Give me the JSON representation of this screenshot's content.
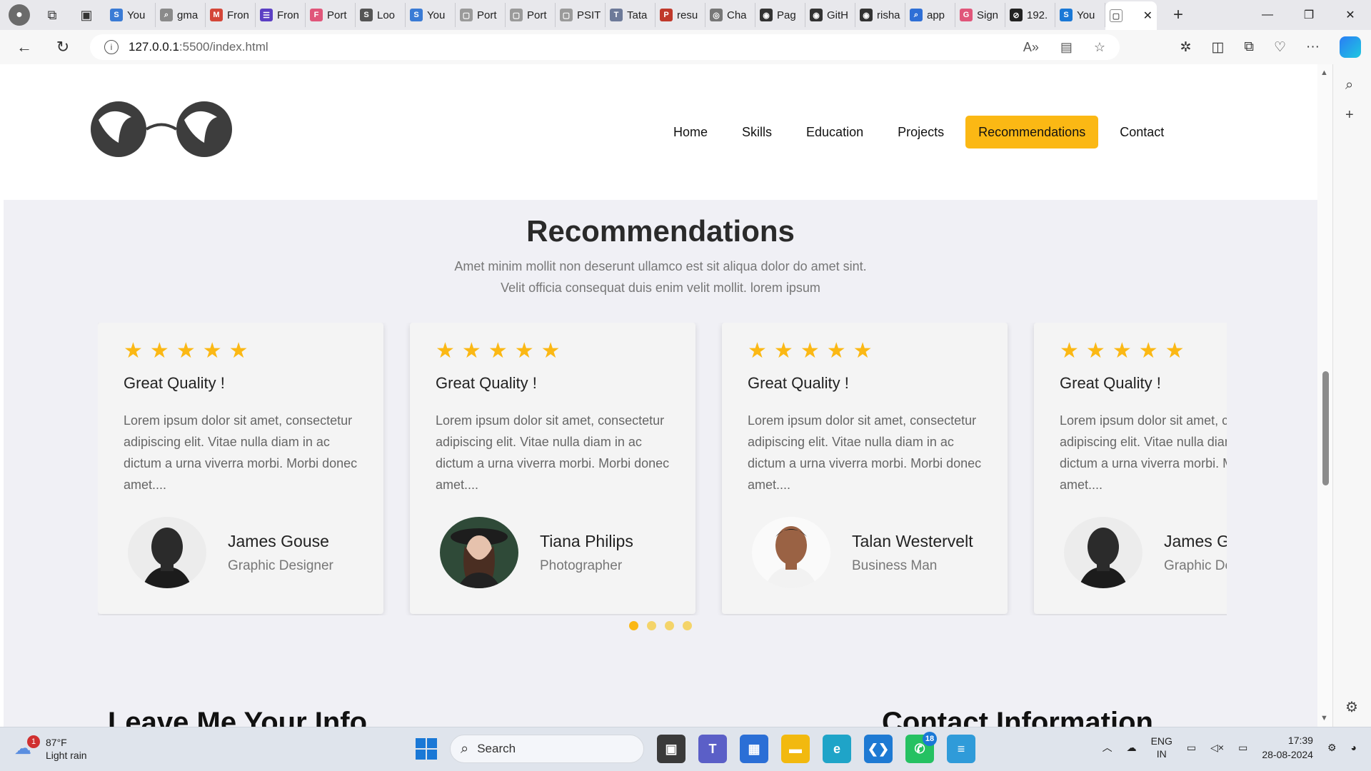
{
  "browser": {
    "tabs": [
      {
        "label": "You",
        "color": "#3a7bd5",
        "glyph": "S"
      },
      {
        "label": "gma",
        "color": "#8a8a8a",
        "glyph": "⌕"
      },
      {
        "label": "Fron",
        "color": "#d44638",
        "glyph": "M"
      },
      {
        "label": "Fron",
        "color": "#5b3fc4",
        "glyph": "☰"
      },
      {
        "label": "Port",
        "color": "#e0567a",
        "glyph": "F"
      },
      {
        "label": "Loo",
        "color": "#555555",
        "glyph": "S"
      },
      {
        "label": "You",
        "color": "#3a7bd5",
        "glyph": "S"
      },
      {
        "label": "Port",
        "color": "#9a9a9a",
        "glyph": "▢"
      },
      {
        "label": "Port",
        "color": "#9a9a9a",
        "glyph": "▢"
      },
      {
        "label": "PSIT",
        "color": "#9a9a9a",
        "glyph": "▢"
      },
      {
        "label": "Tata",
        "color": "#6d7a99",
        "glyph": "T"
      },
      {
        "label": "resu",
        "color": "#c0392b",
        "glyph": "P"
      },
      {
        "label": "Cha",
        "color": "#777777",
        "glyph": "◎"
      },
      {
        "label": "Pag",
        "color": "#333333",
        "glyph": "◉"
      },
      {
        "label": "GitH",
        "color": "#333333",
        "glyph": "◉"
      },
      {
        "label": "risha",
        "color": "#333333",
        "glyph": "◉"
      },
      {
        "label": "app",
        "color": "#2f6fd6",
        "glyph": "⌕"
      },
      {
        "label": "Sign",
        "color": "#e0567a",
        "glyph": "G"
      },
      {
        "label": "192.",
        "color": "#222222",
        "glyph": "⊘"
      },
      {
        "label": "You",
        "color": "#1a78d6",
        "glyph": "S"
      }
    ],
    "url_host": "127.0.0.1",
    "url_path": ":5500/index.html"
  },
  "nav": {
    "items": [
      "Home",
      "Skills",
      "Education",
      "Projects",
      "Recommendations",
      "Contact"
    ],
    "active": "Recommendations"
  },
  "section": {
    "title": "Recommendations",
    "subtitle_line1": "Amet minim mollit non deserunt ullamco est sit aliqua dolor do amet sint.",
    "subtitle_line2": "Velit officia consequat duis enim velit mollit. lorem ipsum"
  },
  "cards": [
    {
      "rating": 5,
      "heading": "Great Quality !",
      "text": "Lorem ipsum dolor sit amet, consectetur adipiscing elit. Vitae nulla diam in ac dictum a urna viverra morbi. Morbi donec amet....",
      "name": "James Gouse",
      "role": "Graphic Designer"
    },
    {
      "rating": 5,
      "heading": "Great Quality !",
      "text": "Lorem ipsum dolor sit amet, consectetur adipiscing elit. Vitae nulla diam in ac dictum a urna viverra morbi. Morbi donec amet....",
      "name": "Tiana Philips",
      "role": "Photographer"
    },
    {
      "rating": 5,
      "heading": "Great Quality !",
      "text": "Lorem ipsum dolor sit amet, consectetur adipiscing elit. Vitae nulla diam in ac dictum a urna viverra morbi. Morbi donec amet....",
      "name": "Talan Westervelt",
      "role": "Business Man"
    },
    {
      "rating": 5,
      "heading": "Great Quality !",
      "text": "Lorem ipsum dolor sit amet, consectetur adipiscing elit. Vitae nulla diam in ac dictum a urna viverra morbi. Morbi donec amet....",
      "name": "James Gouse",
      "role": "Graphic Designer"
    }
  ],
  "carousel": {
    "pages": 4,
    "active_page": 1
  },
  "below": {
    "left_heading": "Leave Me Your Info",
    "right_heading": "Contact Information"
  },
  "taskbar": {
    "weather_temp": "87°F",
    "weather_desc": "Light rain",
    "weather_badge": "1",
    "search_placeholder": "Search",
    "whatsapp_count": "18",
    "lang_line1": "ENG",
    "lang_line2": "IN",
    "time": "17:39",
    "date": "28-08-2024"
  },
  "colors": {
    "accent": "#fbb814",
    "section_bg": "#f0f0f5"
  }
}
